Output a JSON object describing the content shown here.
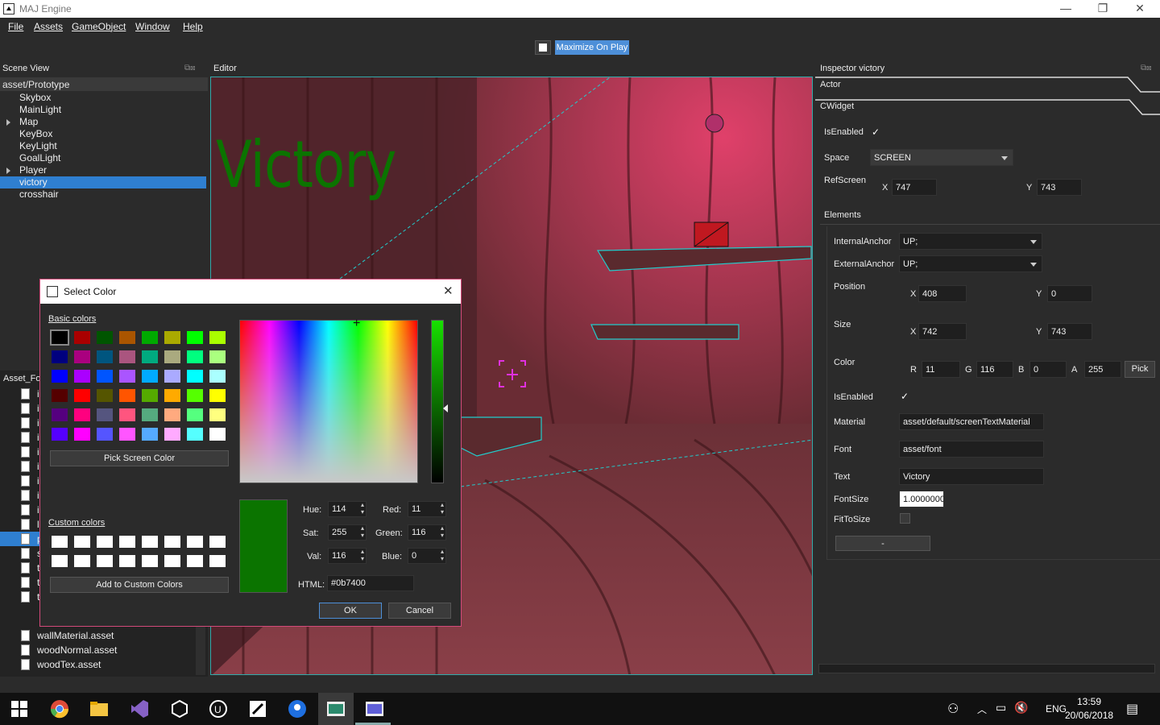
{
  "window": {
    "title": "MAJ Engine",
    "minimize": "—",
    "restore": "❐",
    "close": "✕"
  },
  "menu": [
    {
      "label": "File"
    },
    {
      "label": "Assets"
    },
    {
      "label": "GameObject"
    },
    {
      "label": "Window"
    },
    {
      "label": "Help"
    }
  ],
  "toolbar": {
    "maximize_on_play": "Maximize On Play"
  },
  "scene_view": {
    "title": "Scene View",
    "root": "asset/Prototype",
    "items": [
      {
        "label": "Skybox",
        "arrow": false,
        "selected": false
      },
      {
        "label": "MainLight",
        "arrow": false,
        "selected": false
      },
      {
        "label": "Map",
        "arrow": true,
        "selected": false
      },
      {
        "label": "KeyBox",
        "arrow": false,
        "selected": false
      },
      {
        "label": "KeyLight",
        "arrow": false,
        "selected": false
      },
      {
        "label": "GoalLight",
        "arrow": false,
        "selected": false
      },
      {
        "label": "Player",
        "arrow": true,
        "selected": false
      },
      {
        "label": "victory",
        "arrow": false,
        "selected": true
      },
      {
        "label": "crosshair",
        "arrow": false,
        "selected": false
      }
    ]
  },
  "asset_panel": {
    "title": "Asset_Fo",
    "row_initials": [
      "i",
      "i",
      "i",
      "i",
      "i",
      "i",
      "i",
      "i",
      "i",
      "l",
      "p",
      "s",
      "t",
      "t",
      "t"
    ],
    "files": [
      "wallMaterial.asset",
      "woodNormal.asset",
      "woodTex.asset"
    ]
  },
  "editor": {
    "title": "Editor",
    "overlay_text": "Victory"
  },
  "inspector": {
    "title": "Inspector victory",
    "sections": {
      "actor": "Actor",
      "cwidget": "CWidget",
      "elements": "Elements"
    },
    "is_enabled_label": "IsEnabled",
    "is_enabled": "✓",
    "space_label": "Space",
    "space_value": "SCREEN",
    "refscreen_label": "RefScreen",
    "refscreen_x": "747",
    "refscreen_y": "743",
    "x_label": "X",
    "y_label": "Y",
    "internal_anchor_label": "InternalAnchor",
    "internal_anchor": "UP;",
    "external_anchor_label": "ExternalAnchor",
    "external_anchor": "UP;",
    "position_label": "Position",
    "position_x": "408",
    "position_y": "0",
    "size_label": "Size",
    "size_x": "742",
    "size_y": "743",
    "color_label": "Color",
    "color_r_label": "R",
    "color_r": "11",
    "color_g_label": "G",
    "color_g": "116",
    "color_b_label": "B",
    "color_b": "0",
    "color_a_label": "A",
    "color_a": "255",
    "pick_label": "Pick",
    "el_is_enabled_label": "IsEnabled",
    "el_is_enabled": "✓",
    "material_label": "Material",
    "material": "asset/default/screenTextMaterial",
    "font_label": "Font",
    "font": "asset/font",
    "text_label": "Text",
    "text": "Victory",
    "fontsize_label": "FontSize",
    "fontsize": "1.0000000",
    "fittosize_label": "FitToSize",
    "remove_button": "-"
  },
  "color_dialog": {
    "title": "Select Color",
    "basic_colors_label": "Basic colors",
    "basic_colors": [
      "#000000",
      "#aa0000",
      "#005500",
      "#aa5500",
      "#00aa00",
      "#aaaa00",
      "#00ff00",
      "#aaff00",
      "#00007f",
      "#aa007f",
      "#00557f",
      "#aa557f",
      "#00aa7f",
      "#aaaa7f",
      "#00ff7f",
      "#aaff7f",
      "#0000ff",
      "#aa00ff",
      "#0055ff",
      "#aa55ff",
      "#00aaff",
      "#aaaaff",
      "#00ffff",
      "#aaffff",
      "#550000",
      "#ff0000",
      "#555500",
      "#ff5500",
      "#55aa00",
      "#ffaa00",
      "#55ff00",
      "#ffff00",
      "#55007f",
      "#ff007f",
      "#55557f",
      "#ff557f",
      "#55aa7f",
      "#ffaa7f",
      "#55ff7f",
      "#ffff7f",
      "#5500ff",
      "#ff00ff",
      "#5555ff",
      "#ff55ff",
      "#55aaff",
      "#ffaaff",
      "#55ffff",
      "#ffffff"
    ],
    "pick_screen_color": "Pick Screen Color",
    "custom_colors_label": "Custom colors",
    "add_custom": "Add to Custom Colors",
    "hue_label": "Hue:",
    "hue": "114",
    "sat_label": "Sat:",
    "sat": "255",
    "val_label": "Val:",
    "val": "116",
    "red_label": "Red:",
    "red": "11",
    "green_label": "Green:",
    "green": "116",
    "blue_label": "Blue:",
    "blue": "0",
    "html_label": "HTML:",
    "html": "#0b7400",
    "ok": "OK",
    "cancel": "Cancel",
    "current_color": "#0b7400"
  },
  "taskbar": {
    "lang": "ENG",
    "time": "13:59",
    "date": "20/06/2018"
  }
}
